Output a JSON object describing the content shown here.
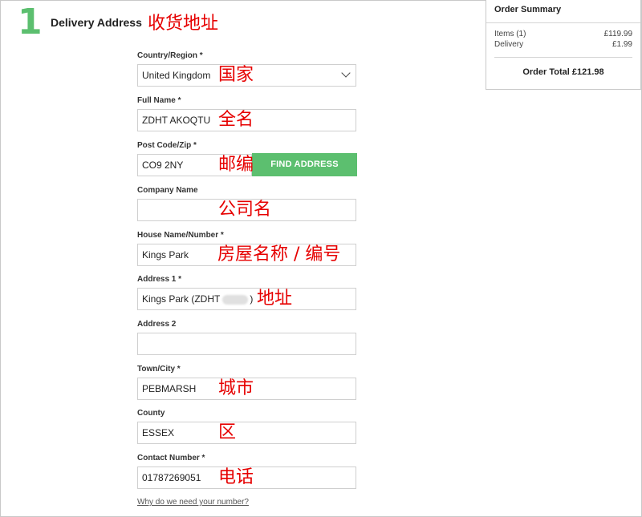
{
  "step": {
    "number": "1",
    "title": "Delivery Address",
    "note": "收货地址"
  },
  "form": {
    "country": {
      "label": "Country/Region *",
      "value": "United Kingdom",
      "note": "国家"
    },
    "full_name": {
      "label": "Full Name *",
      "value": "ZDHT AKOQTU",
      "note": "全名"
    },
    "postcode": {
      "label": "Post Code/Zip *",
      "value": "CO9 2NY",
      "note": "邮编",
      "button": "FIND ADDRESS"
    },
    "company": {
      "label": "Company Name",
      "value": "",
      "note": "公司名"
    },
    "house": {
      "label": "House Name/Number *",
      "value": "Kings Park",
      "note": "房屋名称 / 编号"
    },
    "address1": {
      "label": "Address 1 *",
      "value_prefix": "Kings Park (ZDHT",
      "value_suffix": ")",
      "note": "地址"
    },
    "address2": {
      "label": "Address 2",
      "value": ""
    },
    "town": {
      "label": "Town/City *",
      "value": "PEBMARSH",
      "note": "城市"
    },
    "county": {
      "label": "County",
      "value": "ESSEX",
      "note": "区"
    },
    "contact": {
      "label": "Contact Number *",
      "value": "01787269051",
      "note": "电话"
    },
    "why_link": "Why do we need your number?"
  },
  "summary": {
    "title": "Order Summary",
    "items_label": "Items (1)",
    "items_value": "£119.99",
    "delivery_label": "Delivery",
    "delivery_value": "£1.99",
    "total": "Order Total £121.98"
  },
  "colors": {
    "accent": "#5cbf6f",
    "annotation": "#e60000"
  }
}
